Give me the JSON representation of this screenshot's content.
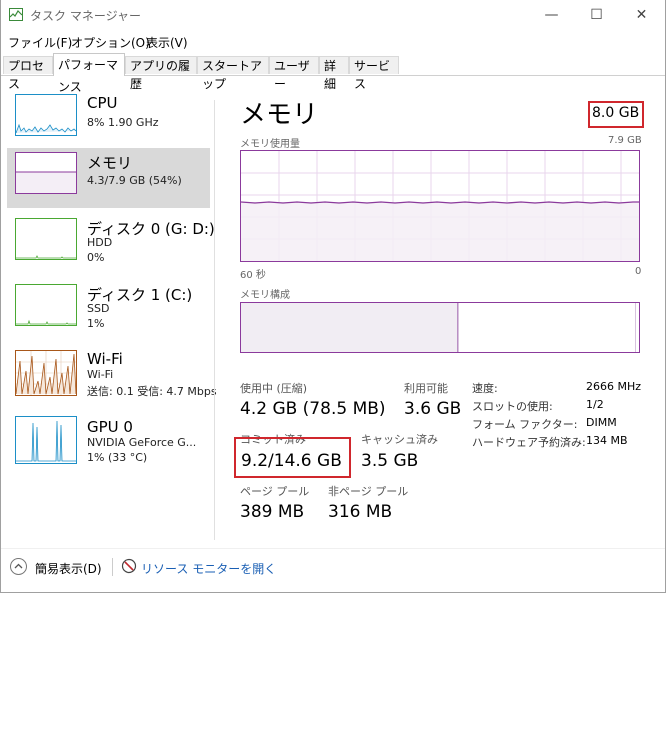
{
  "window": {
    "title": "タスク マネージャー",
    "minimize": "—",
    "maximize": "☐",
    "close": "✕"
  },
  "menu": [
    "ファイル(F)",
    "オプション(O)",
    "表示(V)"
  ],
  "tabs": [
    {
      "label": "プロセス",
      "active": false
    },
    {
      "label": "パフォーマンス",
      "active": true
    },
    {
      "label": "アプリの履歴",
      "active": false
    },
    {
      "label": "スタートアップ",
      "active": false
    },
    {
      "label": "ユーザー",
      "active": false
    },
    {
      "label": "詳細",
      "active": false
    },
    {
      "label": "サービス",
      "active": false
    }
  ],
  "sidebar": {
    "items": [
      {
        "title": "CPU",
        "line1": "8%  1.90 GHz",
        "line2": "",
        "color": "#1c8fc7"
      },
      {
        "title": "メモリ",
        "line1": "4.3/7.9 GB (54%)",
        "line2": "",
        "color": "#8b3a9c"
      },
      {
        "title": "ディスク 0 (G: D:)",
        "line1": "HDD",
        "line2": "0%",
        "color": "#4aa832"
      },
      {
        "title": "ディスク 1 (C:)",
        "line1": "SSD",
        "line2": "1%",
        "color": "#4aa832"
      },
      {
        "title": "Wi-Fi",
        "line1": "Wi-Fi",
        "line2": "送信: 0.1  受信: 4.7 Mbps",
        "color": "#a8571a"
      },
      {
        "title": "GPU 0",
        "line1": "NVIDIA GeForce G...",
        "line2": "1%  (33 °C)",
        "color": "#1c8fc7"
      }
    ]
  },
  "memory": {
    "title": "メモリ",
    "total": "8.0 GB",
    "usage_label": "メモリ使用量",
    "usage_max": "7.9 GB",
    "time_left": "60 秒",
    "time_right": "0",
    "composition_label": "メモリ構成",
    "usage_fraction": 0.54,
    "stats": {
      "in_use_label": "使用中 (圧縮)",
      "in_use_value": "4.2 GB (78.5 MB)",
      "available_label": "利用可能",
      "available_value": "3.6 GB",
      "committed_label": "コミット済み",
      "committed_value": "9.2/14.6 GB",
      "cached_label": "キャッシュ済み",
      "cached_value": "3.5 GB",
      "paged_label": "ページ プール",
      "paged_value": "389 MB",
      "nonpaged_label": "非ページ プール",
      "nonpaged_value": "316 MB"
    },
    "specs": {
      "speed_label": "速度:",
      "speed_value": "2666 MHz",
      "slots_label": "スロットの使用:",
      "slots_value": "1/2",
      "form_label": "フォーム ファクター:",
      "form_value": "DIMM",
      "reserved_label": "ハードウェア予約済み:",
      "reserved_value": "134 MB"
    }
  },
  "footer": {
    "collapse_label": "簡易表示(D)",
    "monitor_label": "リソース モニターを開く"
  }
}
